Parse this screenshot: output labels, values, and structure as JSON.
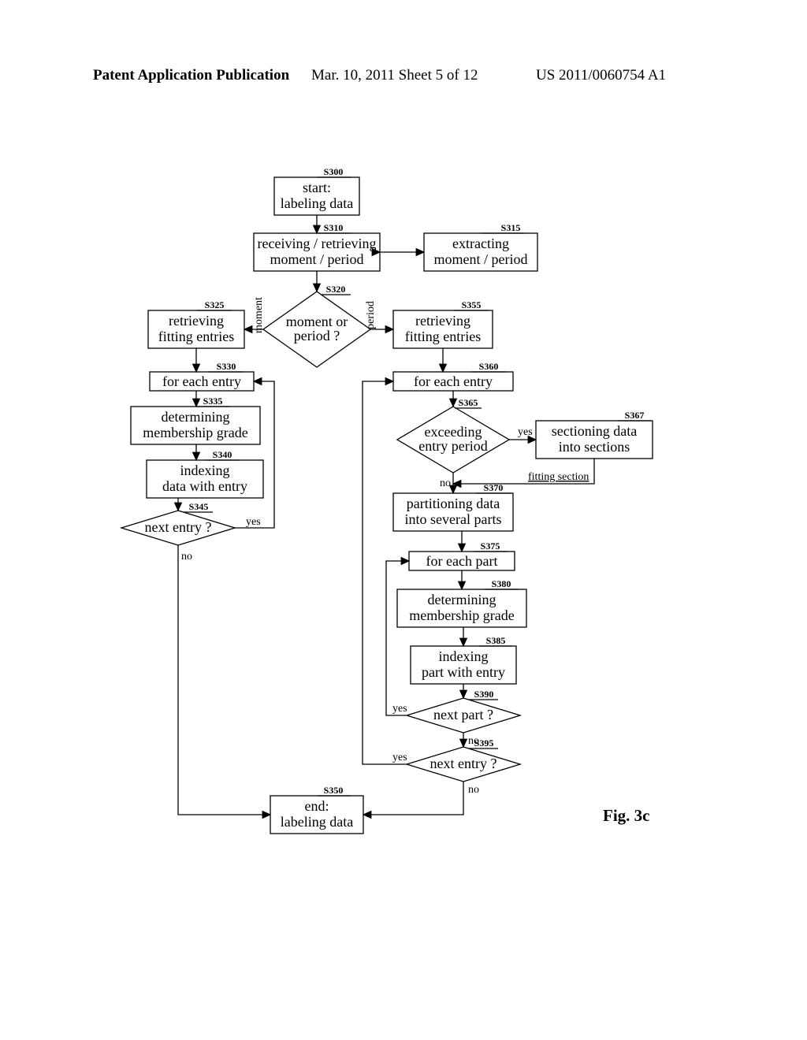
{
  "header": {
    "left": "Patent Application Publication",
    "mid": "Mar. 10, 2011  Sheet 5 of 12",
    "right": "US 2011/0060754 A1"
  },
  "figLabel": "Fig. 3c",
  "nodes": {
    "S300": {
      "l1": "start:",
      "l2": "labeling data"
    },
    "S310": {
      "l1": "receiving / retrieving",
      "l2": "moment / period"
    },
    "S315": {
      "l1": "extracting",
      "l2": "moment / period"
    },
    "S320": {
      "l1": "moment or",
      "l2": "period ?"
    },
    "S325": {
      "l1": "retrieving",
      "l2": "fitting entries"
    },
    "S330": {
      "l1": "for each entry"
    },
    "S335": {
      "l1": "determining",
      "l2": "membership grade"
    },
    "S340": {
      "l1": "indexing",
      "l2": "data with entry"
    },
    "S345": {
      "l1": "next entry ?"
    },
    "S350": {
      "l1": "end:",
      "l2": "labeling data"
    },
    "S355": {
      "l1": "retrieving",
      "l2": "fitting entries"
    },
    "S360": {
      "l1": "for each entry"
    },
    "S365": {
      "l1": "exceeding",
      "l2": "entry period"
    },
    "S367": {
      "l1": "sectioning data",
      "l2": "into sections"
    },
    "S370": {
      "l1": "partitioning data",
      "l2": "into several parts"
    },
    "S375": {
      "l1": "for each part"
    },
    "S380": {
      "l1": "determining",
      "l2": "membership grade"
    },
    "S385": {
      "l1": "indexing",
      "l2": "part with entry"
    },
    "S390": {
      "l1": "next part ?"
    },
    "S395": {
      "l1": "next entry ?"
    }
  },
  "labels": {
    "S300": "S300",
    "S310": "S310",
    "S315": "S315",
    "S320": "S320",
    "S325": "S325",
    "S330": "S330",
    "S335": "S335",
    "S340": "S340",
    "S345": "S345",
    "S350": "S350",
    "S355": "S355",
    "S360": "S360",
    "S365": "S365",
    "S367": "S367",
    "S370": "S370",
    "S375": "S375",
    "S380": "S380",
    "S385": "S385",
    "S390": "S390",
    "S395": "S395"
  },
  "branches": {
    "moment": "moment",
    "period": "period",
    "yes": "yes",
    "no": "no",
    "fittingSection": "fitting section"
  }
}
